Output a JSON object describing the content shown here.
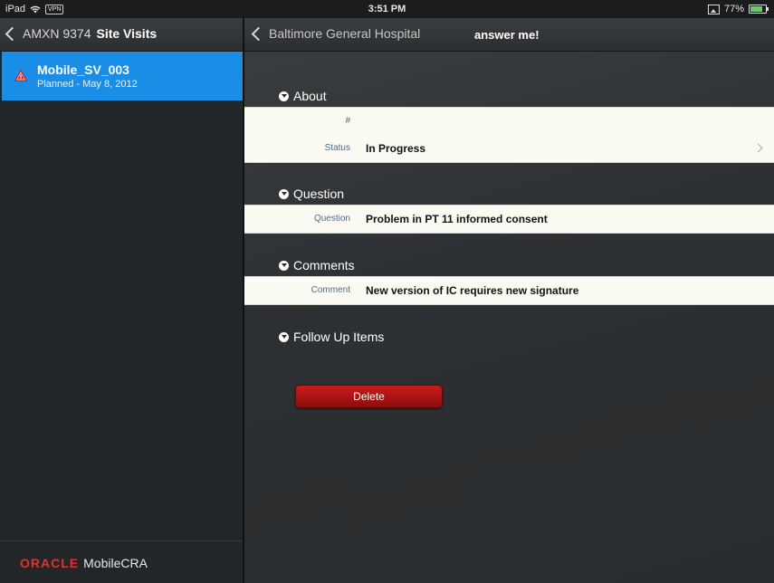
{
  "statusbar": {
    "device": "iPad",
    "vpn": "VPN",
    "time": "3:51 PM",
    "battery": "77%"
  },
  "left": {
    "back_label": "AMXN 9374",
    "title": "Site Visits",
    "item": {
      "title": "Mobile_SV_003",
      "subtitle": "Planned - May 8, 2012"
    },
    "footer": {
      "brand": "ORACLE",
      "product": "MobileCRA"
    }
  },
  "right": {
    "back_label": "Baltimore General Hospital",
    "title": "answer me!",
    "sections": {
      "about": {
        "title": "About",
        "number_label": "#",
        "number_value": "",
        "status_label": "Status",
        "status_value": "In Progress"
      },
      "question": {
        "title": "Question",
        "label": "Question",
        "value": "Problem in PT 11 informed consent"
      },
      "comments": {
        "title": "Comments",
        "label": "Comment",
        "value": "New version of IC requires new signature"
      },
      "follow_up": {
        "title": "Follow Up Items"
      }
    },
    "delete_label": "Delete"
  },
  "colors": {
    "accent": "#1a8ee6",
    "delete": "#b41616",
    "oracle_red": "#e0322d"
  }
}
